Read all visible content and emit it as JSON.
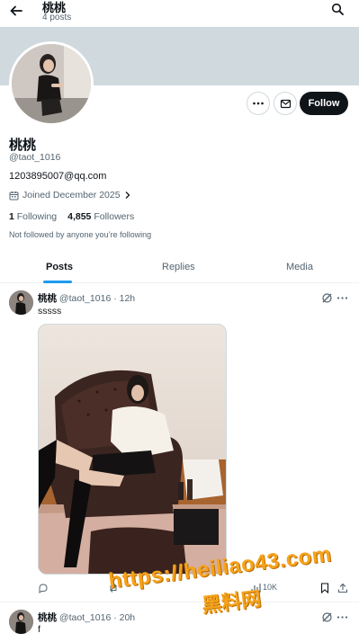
{
  "header": {
    "title": "桃桃",
    "post_count": "4 posts"
  },
  "profile": {
    "display_name": "桃桃",
    "handle": "@taot_1016",
    "bio": "1203895007@qq.com",
    "joined": "Joined December 2025",
    "following_count": "1",
    "following_label": "Following",
    "followers_count": "4,855",
    "followers_label": "Followers",
    "not_followed": "Not followed by anyone you’re following",
    "follow_label": "Follow"
  },
  "tabs": [
    "Posts",
    "Replies",
    "Media"
  ],
  "posts": [
    {
      "name": "桃桃",
      "handle": "@taot_1016",
      "time": "· 12h",
      "text": "sssss",
      "views": "10K"
    },
    {
      "name": "桃桃",
      "handle": "@taot_1016",
      "time": "· 20h",
      "text": "f"
    }
  ],
  "watermark": {
    "url": "https://heiliao43.com",
    "cn": "黑料网"
  },
  "colors": {
    "accent": "#1d9bf0",
    "banner": "#cfd9de",
    "follow_bg": "#0f1419",
    "watermark": "#f6a31b"
  },
  "icons": [
    "back-arrow-icon",
    "search-icon",
    "more-dots-icon",
    "mail-icon",
    "calendar-icon",
    "chevron-right-icon",
    "grok-icon",
    "reply-icon",
    "repost-icon",
    "views-icon",
    "bookmark-icon",
    "share-icon"
  ]
}
